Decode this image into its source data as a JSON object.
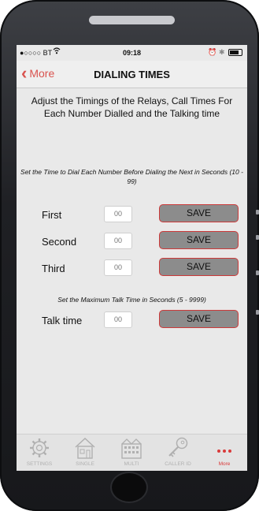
{
  "status_bar": {
    "carrier": "●○○○○ BT",
    "time": "09:18"
  },
  "nav": {
    "back_label": "More",
    "title": "DIALING TIMES"
  },
  "intro_text": "Adjust the Timings of the Relays, Call Times For Each Number Dialled and the Talking time",
  "dial_note": "Set the Time to Dial Each Number Before Dialing the Next in Seconds (10 - 99)",
  "talk_note": "Set the Maximum Talk Time in Seconds (5 - 9999)",
  "rows": [
    {
      "label": "First",
      "placeholder": "00",
      "button": "SAVE"
    },
    {
      "label": "Second",
      "placeholder": "00",
      "button": "SAVE"
    },
    {
      "label": "Third",
      "placeholder": "00",
      "button": "SAVE"
    },
    {
      "label": "Talk time",
      "placeholder": "00",
      "button": "SAVE"
    }
  ],
  "tabs": [
    {
      "label": "SETTINGS",
      "icon": "gear-icon"
    },
    {
      "label": "SINGLE",
      "icon": "house-icon"
    },
    {
      "label": "MULTI",
      "icon": "building-icon"
    },
    {
      "label": "CALLER ID",
      "icon": "key-icon"
    },
    {
      "label": "More",
      "icon": "more-dots-icon",
      "active": true
    }
  ],
  "colors": {
    "accent": "#d9534f",
    "save_bg": "#8c8c8c",
    "screen_bg": "#e9e9e9"
  }
}
